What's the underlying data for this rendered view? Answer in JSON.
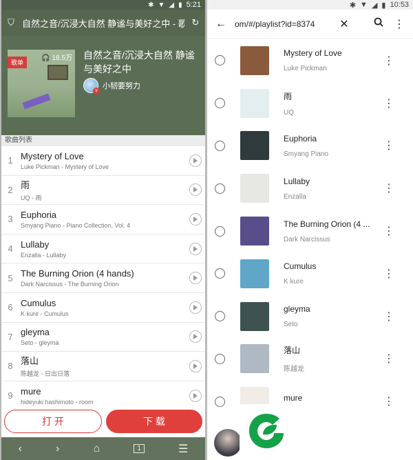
{
  "left": {
    "status_time": "5:21",
    "top_title": "自然之音/沉浸大自然 静谧与美好之中 - 歌",
    "cover_tag": "歌单",
    "plays": "18.5万",
    "playlist_title": "自然之音/沉浸大自然 静谧与美好之中",
    "creator": "小韧要努力",
    "section_label": "歌曲列表",
    "songs": [
      {
        "num": "1",
        "title": "Mystery of Love",
        "sub": "Luke Pickman - Mystery of Love"
      },
      {
        "num": "2",
        "title": "雨",
        "sub": "UQ - 雨"
      },
      {
        "num": "3",
        "title": "Euphoria",
        "sub": "Smyang Piano - Piano Collection, Vol. 4"
      },
      {
        "num": "4",
        "title": "Lullaby",
        "sub": "Enzalla - Lullaby"
      },
      {
        "num": "5",
        "title": "The Burning Orion (4 hands)",
        "sub": "Dark Narcissus - The Burning Orion"
      },
      {
        "num": "6",
        "title": "Cumulus",
        "sub": "K kure - Cumulus"
      },
      {
        "num": "7",
        "title": "gleyma",
        "sub": "Seto - gleyma"
      },
      {
        "num": "8",
        "title": "落山",
        "sub": "陈越龙 - 日出日落"
      },
      {
        "num": "9",
        "title": "mure",
        "sub": "hideyuki hashimoto - room"
      }
    ],
    "open_label": "打 开",
    "download_label": "下 载",
    "tab_count": "1"
  },
  "right": {
    "status_time": "10:53",
    "url": "om/#/playlist?id=8374",
    "tracks": [
      {
        "title": "Mystery of Love",
        "artist": "Luke Pickman",
        "color": "#8a5a3c"
      },
      {
        "title": "雨",
        "artist": "UQ",
        "color": "#e4eef1"
      },
      {
        "title": "Euphoria",
        "artist": "Smyang Piano",
        "color": "#2f3a3d"
      },
      {
        "title": "Lullaby",
        "artist": "Enzalla",
        "color": "#e7e7e3"
      },
      {
        "title": "The Burning Orion (4 ...",
        "artist": "Dark Narcissus",
        "color": "#5a4e8a"
      },
      {
        "title": "Cumulus",
        "artist": "K kure",
        "color": "#5fa6c9"
      },
      {
        "title": "gleyma",
        "artist": "Seto",
        "color": "#3e5350"
      },
      {
        "title": "落山",
        "artist": "陈越龙",
        "color": "#aeb9c4"
      },
      {
        "title": "mure",
        "artist": "",
        "color": "#f2ece6"
      }
    ]
  },
  "logo_color": "#15a149"
}
